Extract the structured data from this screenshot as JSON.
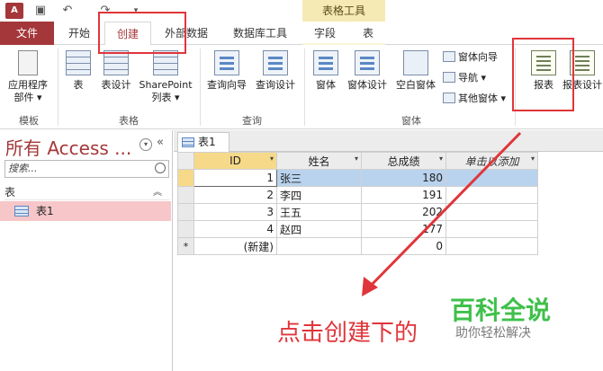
{
  "app_icon_label": "A",
  "context_group_title": "表格工具",
  "tabs": [
    "文件",
    "开始",
    "创建",
    "外部数据",
    "数据库工具",
    "字段",
    "表"
  ],
  "ribbon": {
    "app_parts": [
      "应用程序",
      "部件 ▾"
    ],
    "table": "表",
    "table_design": "表设计",
    "sharepoint": [
      "SharePoint",
      "列表 ▾"
    ],
    "query_wizard": "查询向导",
    "query_design": "查询设计",
    "form": "窗体",
    "form_design": "窗体设计",
    "blank_form": "空白窗体",
    "form_wizard": "窗体向导",
    "navigation": "导航 ▾",
    "more_forms": "其他窗体 ▾",
    "report": "报表",
    "report_design": "报表设计",
    "groups": [
      "模板",
      "表格",
      "查询",
      "窗体"
    ]
  },
  "nav": {
    "title": "所有 Access ...",
    "search_placeholder": "搜索...",
    "section": "表",
    "item": "表1"
  },
  "doc_tab": "表1",
  "grid": {
    "headers": [
      "ID",
      "姓名",
      "总成绩",
      "单击以添加"
    ],
    "rows": [
      {
        "sel": "",
        "id": "1",
        "name": "张三",
        "score": "180"
      },
      {
        "sel": "",
        "id": "2",
        "name": "李四",
        "score": "191"
      },
      {
        "sel": "",
        "id": "3",
        "name": "王五",
        "score": "202"
      },
      {
        "sel": "",
        "id": "4",
        "name": "赵四",
        "score": "177"
      }
    ],
    "new_row": {
      "sel": "*",
      "id": "(新建)",
      "score": "0"
    }
  },
  "annotation": "点击创建下的",
  "watermark": {
    "main": "百科全说",
    "sub": "助你轻松解决"
  },
  "colors": {
    "accent": "#a4373a",
    "annotation": "#e0353a",
    "watermark": "#3fc04a",
    "selection": "#b9d3ee"
  }
}
